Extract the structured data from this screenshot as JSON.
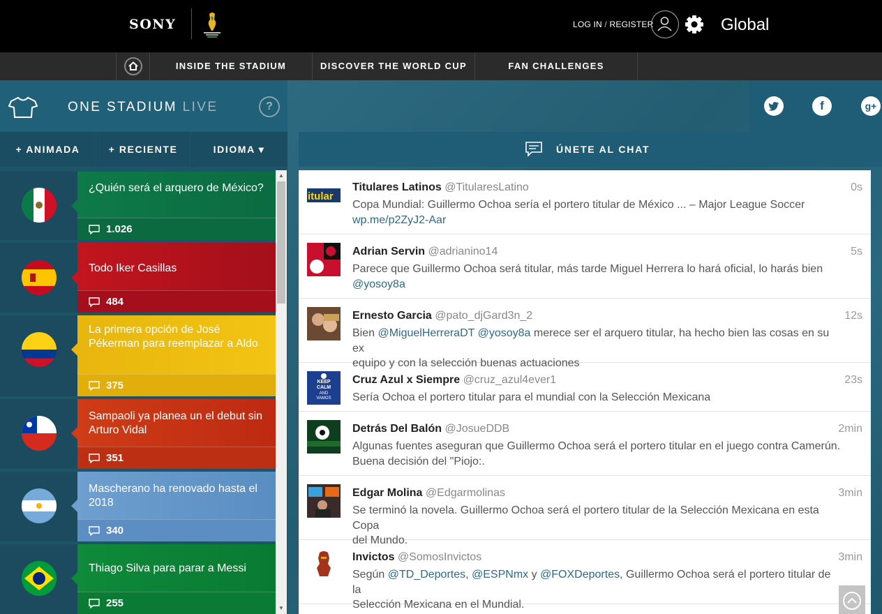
{
  "header": {
    "brand": "SONY",
    "login": "LOG IN",
    "register": "REGISTER",
    "region": "Global"
  },
  "nav": {
    "items": [
      "INSIDE THE STADIUM",
      "DISCOVER THE WORLD CUP",
      "FAN CHALLENGES"
    ]
  },
  "stadium": {
    "title": "ONE STADIUM",
    "live": "LIVE",
    "help": "?"
  },
  "tabs": {
    "animada": "+ ANIMADA",
    "reciente": "+ RECIENTE",
    "idioma": "IDIOMA ▾"
  },
  "topics": [
    {
      "headline": "¿Quién será el arquero de México?",
      "count": "1.026",
      "color": "#0b7a49",
      "flag": "mexico"
    },
    {
      "headline": "Todo Iker Casillas",
      "count": "484",
      "color": "#c2151f",
      "flag": "spain"
    },
    {
      "headline": "La primera opción de José Pékerman para reemplazar a Aldo",
      "count": "375",
      "color": "#f2c413",
      "flag": "colombia"
    },
    {
      "headline": "Sampaoli ya planea un el debut sin Arturo Vidal",
      "count": "351",
      "color": "#cf3c16",
      "flag": "chile"
    },
    {
      "headline": "Mascherano ha renovado hasta el 2018",
      "count": "340",
      "color": "#6e9fd0",
      "flag": "argentina"
    },
    {
      "headline": "Thiago Silva para parar a Messi",
      "count": "255",
      "color": "#0e8a3a",
      "flag": "brazil"
    }
  ],
  "chat": {
    "title": "ÚNETE AL CHAT"
  },
  "tweets": [
    {
      "name": "Titulares Latinos",
      "handle": "@TitularesLatino",
      "time": "0s",
      "line1": "Copa Mundial: Guillermo Ochoa sería el portero titular de México ... – Major League Soccer",
      "line2": "wp.me/p2ZyJ2-Aar",
      "avatar": "titulares-avatar"
    },
    {
      "name": "Adrian Servin",
      "handle": "@adrianino14",
      "time": "5s",
      "line1": "Parece que Guillermo Ochoa será titular, más tarde Miguel Herrera lo hará oficial, lo harás bien",
      "line2": "@yosoy8a",
      "avatar": "adrian-avatar"
    },
    {
      "name": "Ernesto Garcia",
      "handle": "@pato_djGard3n_2",
      "time": "12s",
      "pre": "Bien ",
      "m1": "@MiguelHerreraDT",
      "m2": "@yosoy8a",
      "post": " merece ser el arquero titular, ha hecho bien las cosas en su ex",
      "line2": "equipo y con la selección buenas actuaciones",
      "avatar": "ernesto-avatar"
    },
    {
      "name": "Cruz Azul x Siempre",
      "handle": "@cruz_azul4ever1",
      "time": "23s",
      "line1": "Sería Ochoa el portero titular para el mundial con la Selección Mexicana",
      "avatar": "cruzazul-avatar"
    },
    {
      "name": "Detrás Del Balón",
      "handle": "@JosueDDB",
      "time": "2min",
      "line1": "Algunas fuentes aseguran que Guillermo Ochoa será el portero titular en el juego contra Camerún.",
      "line2": "Buena decisión del \"Piojo:.",
      "avatar": "detras-avatar"
    },
    {
      "name": "Edgar Molina",
      "handle": "@Edgarmolinas",
      "time": "3min",
      "line1": "Se terminó la novela. Guillermo Ochoa será el portero titular de la Selección Mexicana en esta Copa",
      "line2": "del Mundo.",
      "avatar": "edgar-avatar"
    },
    {
      "name": "Invictos",
      "handle": "@SomosInvictos",
      "time": "3min",
      "pre": "Según ",
      "m1": "@TD_Deportes",
      "sep1": ", ",
      "m2": "@ESPNmx",
      "sep2": " y ",
      "m3": "@FOXDeportes",
      "post": ", Guillermo Ochoa será el portero titular de la",
      "line2": "Selección Mexicana en el Mundial.",
      "avatar": "invictos-avatar"
    }
  ]
}
